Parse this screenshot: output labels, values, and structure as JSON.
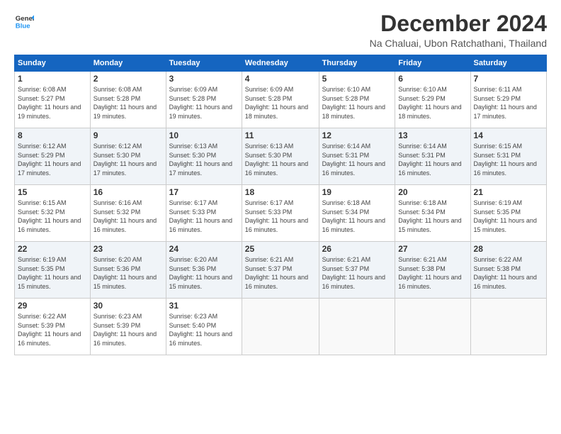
{
  "logo": {
    "line1": "General",
    "line2": "Blue"
  },
  "title": "December 2024",
  "location": "Na Chaluai, Ubon Ratchathani, Thailand",
  "days_of_week": [
    "Sunday",
    "Monday",
    "Tuesday",
    "Wednesday",
    "Thursday",
    "Friday",
    "Saturday"
  ],
  "weeks": [
    [
      {
        "day": "1",
        "sunrise": "6:08 AM",
        "sunset": "5:27 PM",
        "daylight": "11 hours and 19 minutes."
      },
      {
        "day": "2",
        "sunrise": "6:08 AM",
        "sunset": "5:28 PM",
        "daylight": "11 hours and 19 minutes."
      },
      {
        "day": "3",
        "sunrise": "6:09 AM",
        "sunset": "5:28 PM",
        "daylight": "11 hours and 19 minutes."
      },
      {
        "day": "4",
        "sunrise": "6:09 AM",
        "sunset": "5:28 PM",
        "daylight": "11 hours and 18 minutes."
      },
      {
        "day": "5",
        "sunrise": "6:10 AM",
        "sunset": "5:28 PM",
        "daylight": "11 hours and 18 minutes."
      },
      {
        "day": "6",
        "sunrise": "6:10 AM",
        "sunset": "5:29 PM",
        "daylight": "11 hours and 18 minutes."
      },
      {
        "day": "7",
        "sunrise": "6:11 AM",
        "sunset": "5:29 PM",
        "daylight": "11 hours and 17 minutes."
      }
    ],
    [
      {
        "day": "8",
        "sunrise": "6:12 AM",
        "sunset": "5:29 PM",
        "daylight": "11 hours and 17 minutes."
      },
      {
        "day": "9",
        "sunrise": "6:12 AM",
        "sunset": "5:30 PM",
        "daylight": "11 hours and 17 minutes."
      },
      {
        "day": "10",
        "sunrise": "6:13 AM",
        "sunset": "5:30 PM",
        "daylight": "11 hours and 17 minutes."
      },
      {
        "day": "11",
        "sunrise": "6:13 AM",
        "sunset": "5:30 PM",
        "daylight": "11 hours and 16 minutes."
      },
      {
        "day": "12",
        "sunrise": "6:14 AM",
        "sunset": "5:31 PM",
        "daylight": "11 hours and 16 minutes."
      },
      {
        "day": "13",
        "sunrise": "6:14 AM",
        "sunset": "5:31 PM",
        "daylight": "11 hours and 16 minutes."
      },
      {
        "day": "14",
        "sunrise": "6:15 AM",
        "sunset": "5:31 PM",
        "daylight": "11 hours and 16 minutes."
      }
    ],
    [
      {
        "day": "15",
        "sunrise": "6:15 AM",
        "sunset": "5:32 PM",
        "daylight": "11 hours and 16 minutes."
      },
      {
        "day": "16",
        "sunrise": "6:16 AM",
        "sunset": "5:32 PM",
        "daylight": "11 hours and 16 minutes."
      },
      {
        "day": "17",
        "sunrise": "6:17 AM",
        "sunset": "5:33 PM",
        "daylight": "11 hours and 16 minutes."
      },
      {
        "day": "18",
        "sunrise": "6:17 AM",
        "sunset": "5:33 PM",
        "daylight": "11 hours and 16 minutes."
      },
      {
        "day": "19",
        "sunrise": "6:18 AM",
        "sunset": "5:34 PM",
        "daylight": "11 hours and 16 minutes."
      },
      {
        "day": "20",
        "sunrise": "6:18 AM",
        "sunset": "5:34 PM",
        "daylight": "11 hours and 15 minutes."
      },
      {
        "day": "21",
        "sunrise": "6:19 AM",
        "sunset": "5:35 PM",
        "daylight": "11 hours and 15 minutes."
      }
    ],
    [
      {
        "day": "22",
        "sunrise": "6:19 AM",
        "sunset": "5:35 PM",
        "daylight": "11 hours and 15 minutes."
      },
      {
        "day": "23",
        "sunrise": "6:20 AM",
        "sunset": "5:36 PM",
        "daylight": "11 hours and 15 minutes."
      },
      {
        "day": "24",
        "sunrise": "6:20 AM",
        "sunset": "5:36 PM",
        "daylight": "11 hours and 15 minutes."
      },
      {
        "day": "25",
        "sunrise": "6:21 AM",
        "sunset": "5:37 PM",
        "daylight": "11 hours and 16 minutes."
      },
      {
        "day": "26",
        "sunrise": "6:21 AM",
        "sunset": "5:37 PM",
        "daylight": "11 hours and 16 minutes."
      },
      {
        "day": "27",
        "sunrise": "6:21 AM",
        "sunset": "5:38 PM",
        "daylight": "11 hours and 16 minutes."
      },
      {
        "day": "28",
        "sunrise": "6:22 AM",
        "sunset": "5:38 PM",
        "daylight": "11 hours and 16 minutes."
      }
    ],
    [
      {
        "day": "29",
        "sunrise": "6:22 AM",
        "sunset": "5:39 PM",
        "daylight": "11 hours and 16 minutes."
      },
      {
        "day": "30",
        "sunrise": "6:23 AM",
        "sunset": "5:39 PM",
        "daylight": "11 hours and 16 minutes."
      },
      {
        "day": "31",
        "sunrise": "6:23 AM",
        "sunset": "5:40 PM",
        "daylight": "11 hours and 16 minutes."
      },
      null,
      null,
      null,
      null
    ]
  ]
}
